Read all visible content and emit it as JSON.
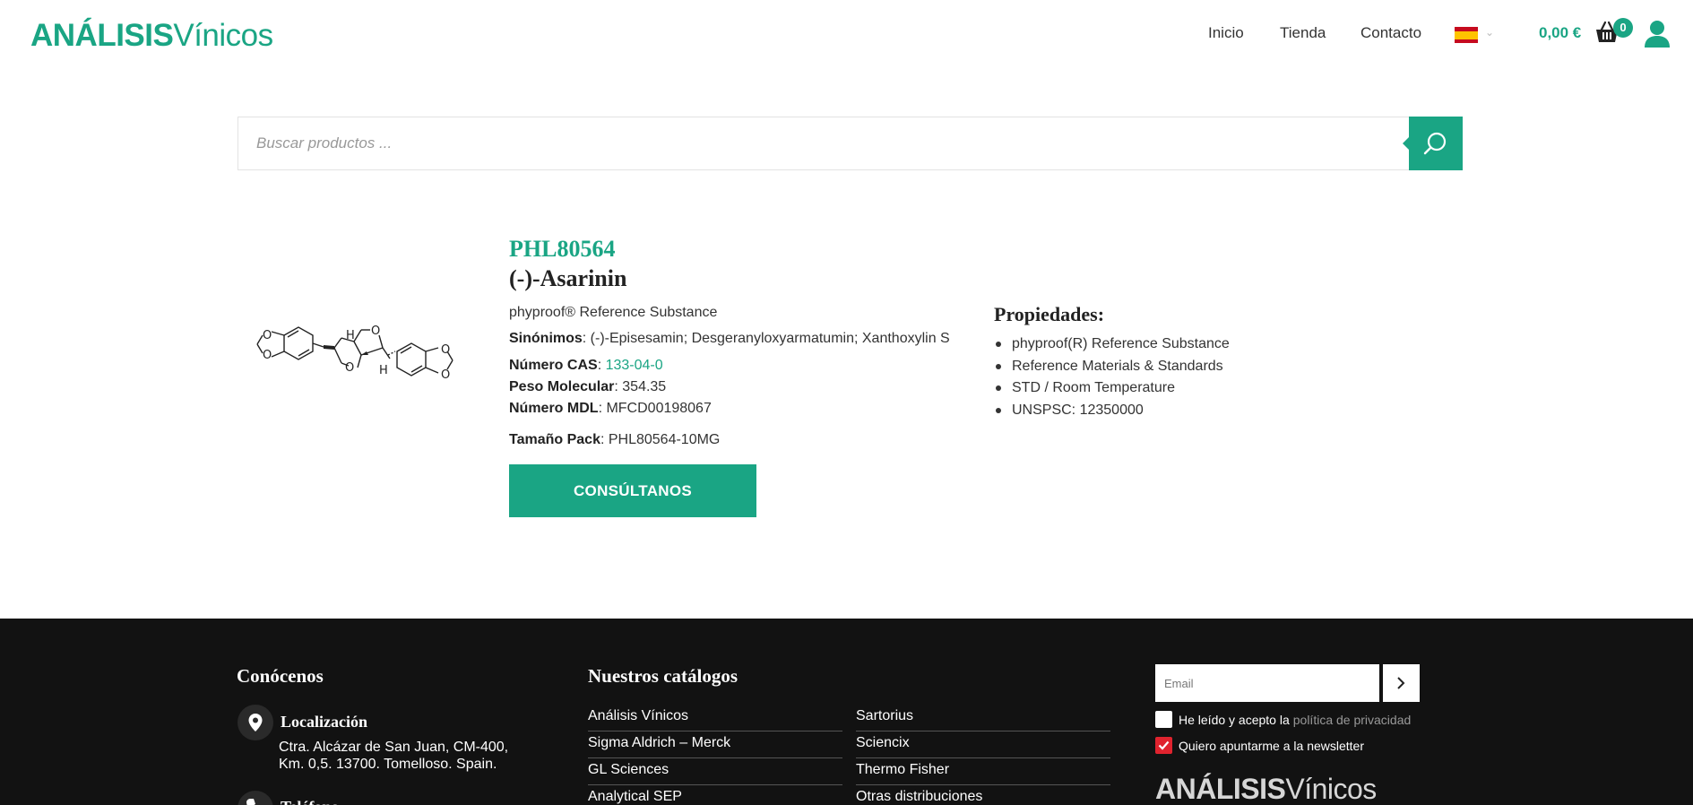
{
  "header": {
    "logo_bold": "ANÁLISIS",
    "logo_light": "Vínicos",
    "nav": [
      "Inicio",
      "Tienda",
      "Contacto"
    ],
    "cart_total": "0,00 €",
    "cart_count": "0",
    "language_icon": "spain-flag-icon"
  },
  "search": {
    "placeholder": "Buscar productos ..."
  },
  "product": {
    "sku": "PHL80564",
    "name": "(-)-Asarinin",
    "subtitle": "phyproof® Reference Substance",
    "synonyms_label": "Sinónimos",
    "synonyms_value": "(-)-Episesamin; Desgeranyloxyarmatumin; Xanthoxylin S",
    "cas_label": "Número CAS",
    "cas_value": "133-04-0",
    "mw_label": "Peso Molecular",
    "mw_value": "354.35",
    "mdl_label": "Número MDL",
    "mdl_value": "MFCD00198067",
    "pack_label": "Tamaño Pack",
    "pack_value": "PHL80564-10MG",
    "consult_label": "CONSÚLTANOS",
    "structure_labels": {
      "h_top": "H",
      "h_bottom": "H",
      "o": "O"
    }
  },
  "properties": {
    "title": "Propiedades:",
    "items": [
      "phyproof(R) Reference Substance",
      "Reference Materials & Standards",
      "STD / Room Temperature",
      "UNSPSC: 12350000"
    ]
  },
  "footer": {
    "about_title": "Conócenos",
    "location_title": "Localización",
    "location_line1": "Ctra. Alcázar de San Juan, CM-400,",
    "location_line2": "Km. 0,5. 13700. Tomelloso. Spain.",
    "phone_title": "Teléfono",
    "catalogs_title": "Nuestros catálogos",
    "catalogs_col1": [
      "Análisis Vínicos",
      "Sigma Aldrich – Merck",
      "GL Sciences",
      "Analytical SEP"
    ],
    "catalogs_col2": [
      "Sartorius",
      "Sciencix",
      "Thermo Fisher",
      "Otras distribuciones"
    ],
    "email_placeholder": "Email",
    "privacy_text": "He leído y acepto la",
    "privacy_link": "política de privacidad",
    "privacy_checked": false,
    "newsletter_text": "Quiero apuntarme a la newsletter",
    "newsletter_checked": true,
    "logo_bold": "ANÁLISIS",
    "logo_light": "Vínicos"
  },
  "colors": {
    "brand": "#1aa584",
    "footer_bg": "#121212",
    "checkbox_checked": "#e0232e"
  }
}
